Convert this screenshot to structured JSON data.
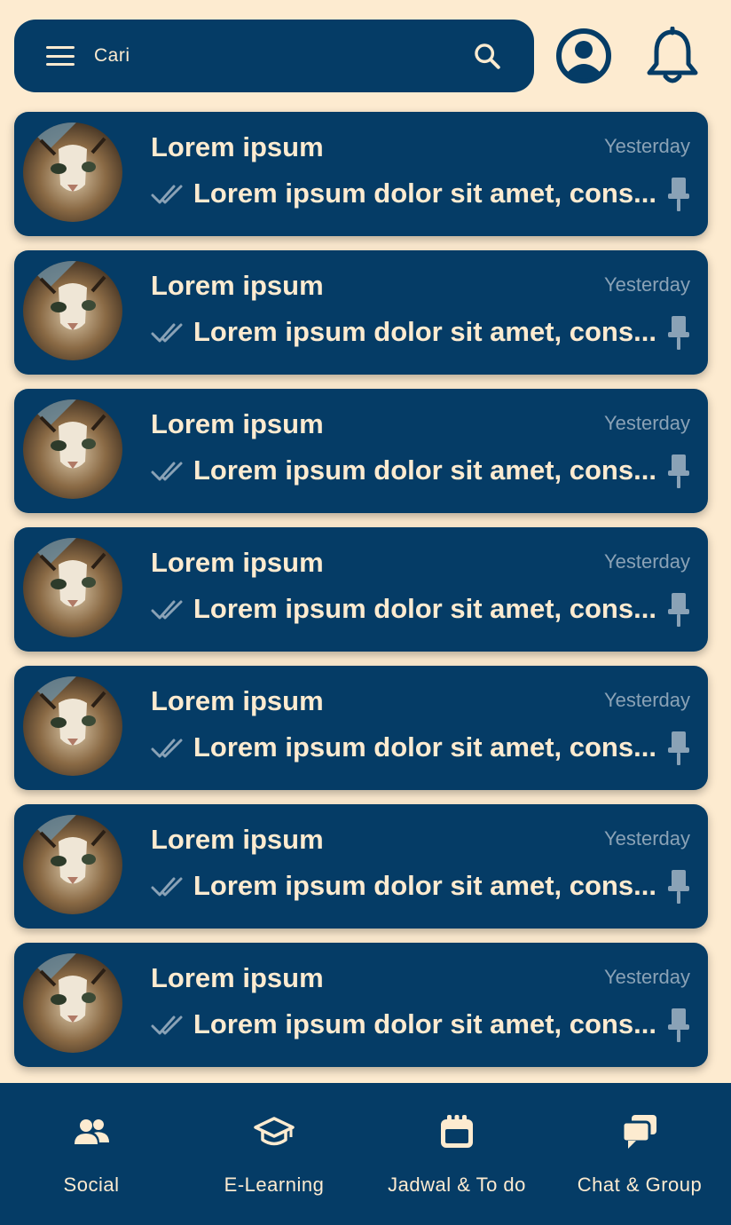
{
  "colors": {
    "background": "#fdebd0",
    "primary": "#053c66",
    "text_light": "#fdebd0",
    "muted": "#8aa2b6"
  },
  "header": {
    "search_label": "Cari",
    "menu_icon": "menu-icon",
    "search_icon": "search-icon",
    "profile_icon": "user-circle-icon",
    "notification_icon": "bell-icon"
  },
  "chats": [
    {
      "name": "Lorem ipsum",
      "time": "Yesterday",
      "preview": "Lorem ipsum dolor sit amet, cons...",
      "status_icon": "double-check-icon",
      "pin_icon": "pin-icon"
    },
    {
      "name": "Lorem ipsum",
      "time": "Yesterday",
      "preview": "Lorem ipsum dolor sit amet, cons...",
      "status_icon": "double-check-icon",
      "pin_icon": "pin-icon"
    },
    {
      "name": "Lorem ipsum",
      "time": "Yesterday",
      "preview": "Lorem ipsum dolor sit amet, cons...",
      "status_icon": "double-check-icon",
      "pin_icon": "pin-icon"
    },
    {
      "name": "Lorem ipsum",
      "time": "Yesterday",
      "preview": "Lorem ipsum dolor sit amet, cons...",
      "status_icon": "double-check-icon",
      "pin_icon": "pin-icon"
    },
    {
      "name": "Lorem ipsum",
      "time": "Yesterday",
      "preview": "Lorem ipsum dolor sit amet, cons...",
      "status_icon": "double-check-icon",
      "pin_icon": "pin-icon"
    },
    {
      "name": "Lorem ipsum",
      "time": "Yesterday",
      "preview": "Lorem ipsum dolor sit amet, cons...",
      "status_icon": "double-check-icon",
      "pin_icon": "pin-icon"
    },
    {
      "name": "Lorem ipsum",
      "time": "Yesterday",
      "preview": "Lorem ipsum dolor sit amet, cons...",
      "status_icon": "double-check-icon",
      "pin_icon": "pin-icon"
    }
  ],
  "bottom_nav": [
    {
      "label": "Social",
      "icon": "users-icon"
    },
    {
      "label": "E-Learning",
      "icon": "graduation-cap-icon"
    },
    {
      "label": "Jadwal & To do",
      "icon": "calendar-icon"
    },
    {
      "label": "Chat & Group",
      "icon": "chat-bubbles-icon"
    }
  ]
}
